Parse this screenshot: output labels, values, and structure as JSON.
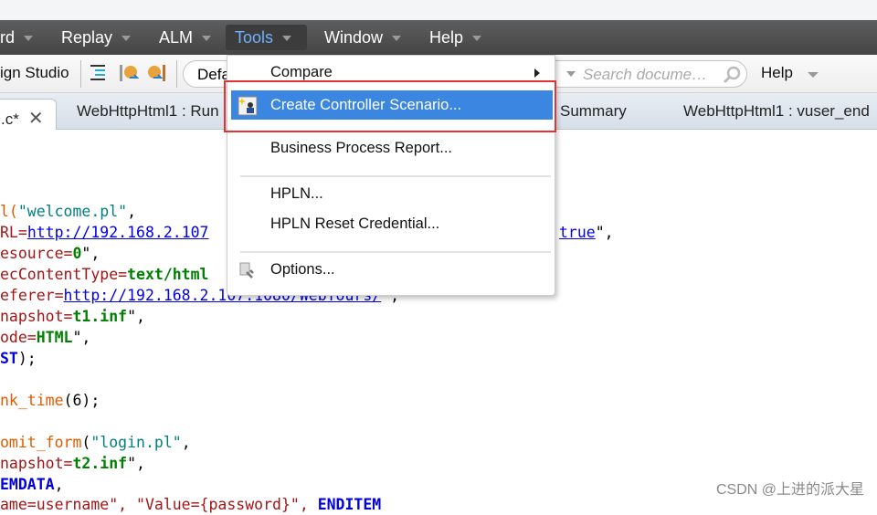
{
  "menubar": {
    "items": [
      "rd",
      "Replay",
      "ALM",
      "Tools",
      "Window",
      "Help"
    ],
    "active": "Tools"
  },
  "toolbar": {
    "design_studio": "ign Studio",
    "combo_text": "Defa",
    "search_placeholder": "Search docume…",
    "help": "Help"
  },
  "tabs": [
    {
      "label": ".c*",
      "selected": true
    },
    {
      "label": "WebHttpHtml1 : Run"
    },
    {
      "label": "Summary"
    },
    {
      "label": "WebHttpHtml1 : vuser_end"
    }
  ],
  "code": {
    "l1": [
      "l(",
      "\"welcome.pl\"",
      ","
    ],
    "l2": [
      "RL=",
      "http://192.168.2.107",
      "true",
      "\","
    ],
    "l3": [
      "esource=",
      "0",
      "\","
    ],
    "l4": [
      "ecContentType=",
      "text/html"
    ],
    "l5": [
      "eferer=",
      "http://192.168.2.107:1080/WebTours/",
      "\","
    ],
    "l6": [
      "napshot=",
      "t1.inf",
      "\","
    ],
    "l7": [
      "ode=",
      "HTML",
      "\","
    ],
    "l8": [
      "ST",
      ");"
    ],
    "l9": [
      "nk_time",
      "(6);"
    ],
    "l10": [
      "omit_form",
      "(",
      "\"login.pl\"",
      ","
    ],
    "l11": [
      "napshot=",
      "t2.inf",
      "\","
    ],
    "l12": [
      "EMDATA",
      ","
    ],
    "l13": [
      "ame=username\", \"Value={password}\", ",
      "ENDITEM"
    ]
  },
  "tools_menu": {
    "items": [
      {
        "label": "Compare",
        "submenu": true
      },
      {
        "label": "Create Controller Scenario...",
        "highlighted": true,
        "icon": "controller-scenario-icon"
      },
      {
        "label": "Business Process Report..."
      },
      {
        "label": "HPLN..."
      },
      {
        "label": "HPLN Reset Credential..."
      },
      {
        "label": "Options...",
        "icon": "options-icon"
      }
    ]
  },
  "watermark": "CSDN @上进的派大星",
  "colors": {
    "highlight": "#3a86e0",
    "annotation_box": "#e53333",
    "menubar": "#4f4f4f"
  }
}
